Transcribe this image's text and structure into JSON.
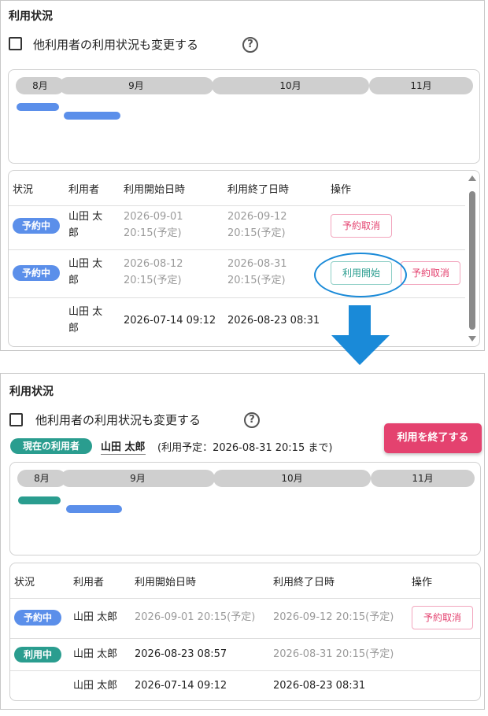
{
  "top": {
    "title": "利用状況",
    "checkbox_label": "他利用者の利用状況も変更する",
    "help": "?",
    "months": [
      "8月",
      "9月",
      "10月",
      "11月"
    ],
    "headers": [
      "状況",
      "利用者",
      "利用開始日時",
      "利用終了日時",
      "操作"
    ],
    "rows": [
      {
        "status": "予約中",
        "user": [
          "山田 太",
          "郎"
        ],
        "start": [
          "2026-09-01",
          "20:15(予定)"
        ],
        "end": [
          "2026-09-12",
          "20:15(予定)"
        ],
        "action": "予約取消"
      },
      {
        "status": "予約中",
        "user": [
          "山田 太",
          "郎"
        ],
        "start": [
          "2026-08-12",
          "20:15(予定)"
        ],
        "end": [
          "2026-08-31",
          "20:15(予定)"
        ],
        "action_start": "利用開始",
        "action": "予約取消"
      },
      {
        "status": "",
        "user": [
          "山田 太",
          "郎"
        ],
        "start": [
          "2026-07-14 09:12"
        ],
        "end": [
          "2026-08-23 08:31"
        ]
      }
    ]
  },
  "bottom": {
    "title": "利用状況",
    "checkbox_label": "他利用者の利用状況も変更する",
    "help": "?",
    "current_user_badge": "現在の利用者",
    "current_user_name": "山田 太郎",
    "schedule_note": "(利用予定：2026-08-31 20:15 まで)",
    "end_button": "利用を終了する",
    "months": [
      "8月",
      "9月",
      "10月",
      "11月"
    ],
    "headers": [
      "状況",
      "利用者",
      "利用開始日時",
      "利用終了日時",
      "操作"
    ],
    "rows": [
      {
        "status": "予約中",
        "user": "山田 太郎",
        "start": "2026-09-01 20:15(予定)",
        "end": "2026-09-12 20:15(予定)",
        "action": "予約取消"
      },
      {
        "status": "利用中",
        "user": "山田 太郎",
        "start": "2026-08-23 08:57",
        "end": "2026-08-31 20:15(予定)"
      },
      {
        "status": "",
        "user": "山田 太郎",
        "start": "2026-07-14 09:12",
        "end": "2026-08-23 08:31"
      }
    ]
  },
  "colors": {
    "reserved": "#5b8fea",
    "in_use": "#2a9d8f",
    "cancel": "#e4426f",
    "arrow": "#1a8ad8"
  }
}
